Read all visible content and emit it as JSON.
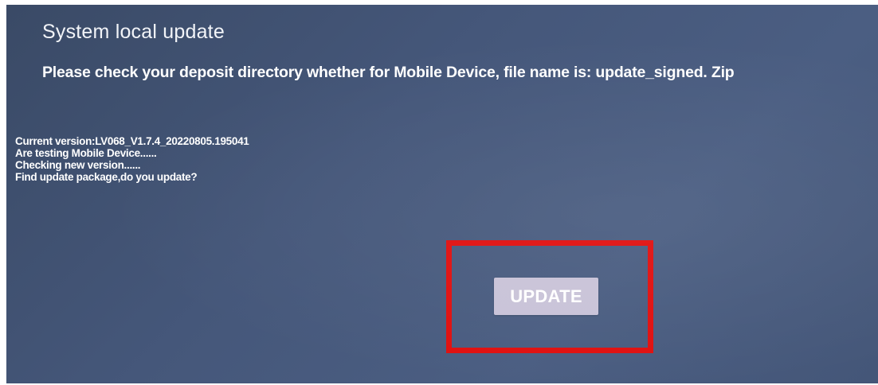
{
  "screen": {
    "title": "System local update",
    "subtitle": "Please check your deposit directory whether for Mobile Device, file name is: update_signed. Zip",
    "log": [
      "Current version:LV068_V1.7.4_20220805.195041",
      "Are testing Mobile Device......",
      "Checking new version......",
      "Find update package,do you update?"
    ],
    "update_button_label": "UPDATE"
  },
  "colors": {
    "background": "#45577a",
    "highlight_border": "#e01010",
    "button_background": "#c9c3d8",
    "text": "#ffffff"
  }
}
